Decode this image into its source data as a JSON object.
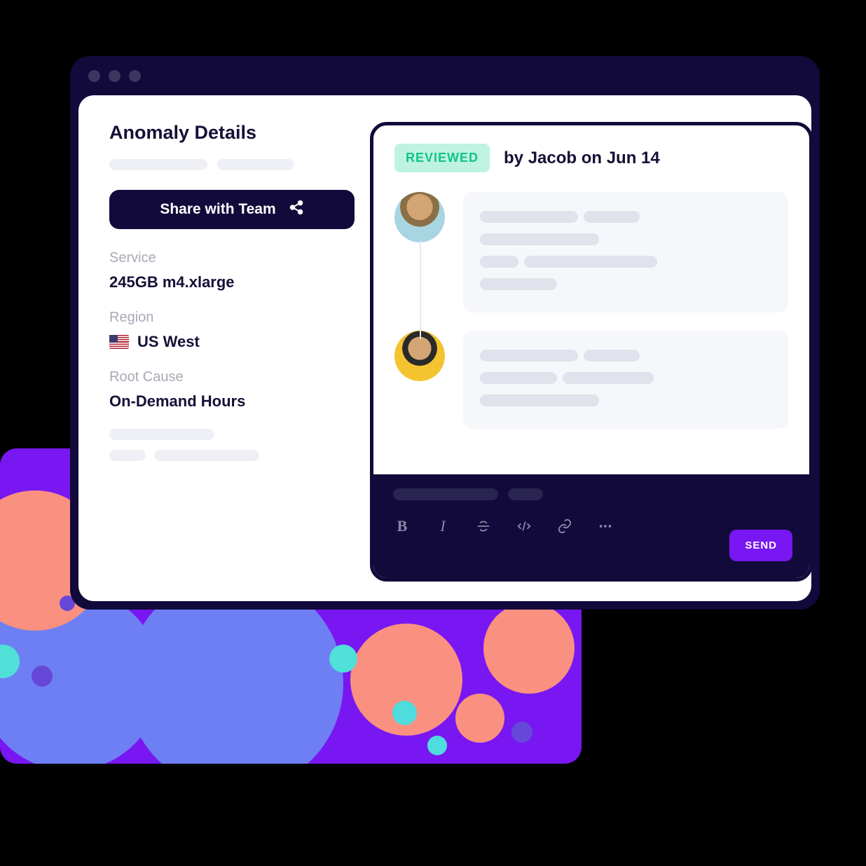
{
  "page": {
    "title": "Anomaly Details"
  },
  "share": {
    "label": "Share with Team"
  },
  "fields": {
    "service": {
      "label": "Service",
      "value": "245GB m4.xlarge"
    },
    "region": {
      "label": "Region",
      "value": "US West"
    },
    "rootCause": {
      "label": "Root Cause",
      "value": "On-Demand Hours"
    }
  },
  "review": {
    "badge": "REVIEWED",
    "byline": "by Jacob on Jun 14"
  },
  "composer": {
    "sendLabel": "SEND"
  },
  "icons": {
    "share": "share-icon",
    "bold": "bold-icon",
    "italic": "italic-icon",
    "strike": "strikethrough-icon",
    "code": "code-icon",
    "link": "link-icon",
    "more": "more-icon"
  },
  "colors": {
    "accent": "#7817f2",
    "dark": "#110a3a",
    "badgeBg": "#bff3e1",
    "badgeText": "#12c48b"
  }
}
